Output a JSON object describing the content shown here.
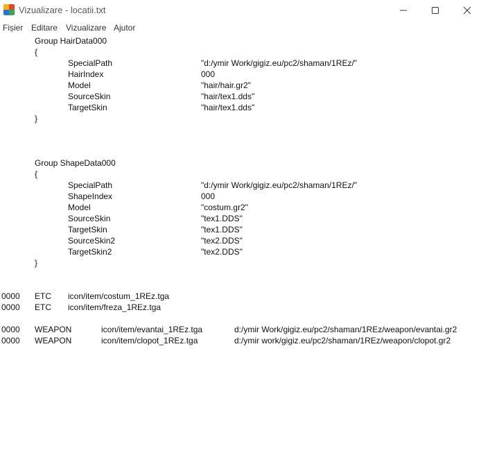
{
  "window": {
    "title": "Vizualizare - locatii.txt",
    "icon": "notepad-app-icon",
    "controls": [
      "minimize-icon",
      "maximize-icon",
      "close-icon"
    ]
  },
  "menu": {
    "fisier": "Fișier",
    "editare": "Editare",
    "vizualizare": "Vizualizare",
    "ajutor": "Ajutor"
  },
  "content": {
    "hair_group": {
      "header": "Group HairData000",
      "open": "{",
      "close": "}",
      "rows": [
        {
          "key": "SpecialPath",
          "value": "\"d:/ymir Work/gigiz.eu/pc2/shaman/1REz/\""
        },
        {
          "key": "HairIndex",
          "value": "000"
        },
        {
          "key": "Model",
          "value": "\"hair/hair.gr2\""
        },
        {
          "key": "SourceSkin",
          "value": "\"hair/tex1.dds\""
        },
        {
          "key": "TargetSkin",
          "value": "\"hair/tex1.dds\""
        }
      ]
    },
    "shape_group": {
      "header": "Group ShapeData000",
      "open": "{",
      "close": "}",
      "rows": [
        {
          "key": "SpecialPath",
          "value": "\"d:/ymir Work/gigiz.eu/pc2/shaman/1REz/\""
        },
        {
          "key": "ShapeIndex",
          "value": "000"
        },
        {
          "key": "Model",
          "value": "\"costum.gr2\""
        },
        {
          "key": "SourceSkin",
          "value": "\"tex1.DDS\""
        },
        {
          "key": "TargetSkin",
          "value": "\"tex1.DDS\""
        },
        {
          "key": "SourceSkin2",
          "value": "\"tex2.DDS\""
        },
        {
          "key": "TargetSkin2",
          "value": "\"tex2.DDS\""
        }
      ]
    },
    "etc_rows": [
      {
        "id": "0000",
        "type": "ETC",
        "icon": "icon/item/costum_1REz.tga"
      },
      {
        "id": "0000",
        "type": "ETC",
        "icon": "icon/item/freza_1REz.tga"
      }
    ],
    "weapon_rows": [
      {
        "id": "0000",
        "type": "WEAPON",
        "icon": "icon/item/evantai_1REz.tga",
        "model": "d:/ymir Work/gigiz.eu/pc2/shaman/1REz/weapon/evantai.gr2"
      },
      {
        "id": "0000",
        "type": "WEAPON",
        "icon": "icon/item/clopot_1REz.tga",
        "model": "d:/ymir work/gigiz.eu/pc2/shaman/1REz/weapon/clopot.gr2"
      }
    ]
  }
}
